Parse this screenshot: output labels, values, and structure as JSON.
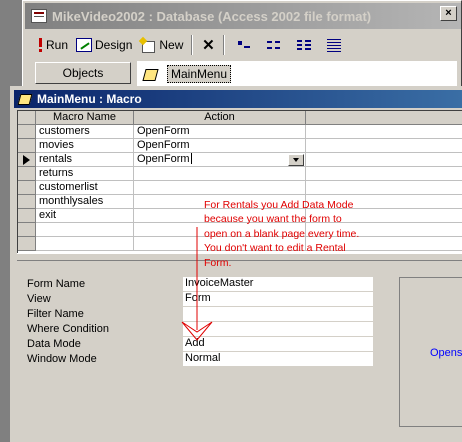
{
  "db_window": {
    "title": "MikeVideo2002 : Database (Access 2002 file format)",
    "close_glyph": "×",
    "toolbar": {
      "run_label": "Run",
      "design_label": "Design",
      "new_label": "New"
    },
    "objects_label": "Objects",
    "selected_object": "MainMenu"
  },
  "macro_window": {
    "title": "MainMenu : Macro",
    "columns": [
      "Macro Name",
      "Action"
    ],
    "rows": [
      {
        "macro_name": "customers",
        "action": "OpenForm"
      },
      {
        "macro_name": "movies",
        "action": "OpenForm"
      },
      {
        "macro_name": "rentals",
        "action": "OpenForm"
      },
      {
        "macro_name": "returns",
        "action": ""
      },
      {
        "macro_name": "customerlist",
        "action": ""
      },
      {
        "macro_name": "monthlysales",
        "action": ""
      },
      {
        "macro_name": "exit",
        "action": ""
      }
    ],
    "current_row": 2
  },
  "action_arguments": {
    "form_name": {
      "label": "Form Name",
      "value": "InvoiceMaster"
    },
    "view": {
      "label": "View",
      "value": "Form"
    },
    "filter_name": {
      "label": "Filter Name",
      "value": ""
    },
    "where_condition": {
      "label": "Where Condition",
      "value": ""
    },
    "data_mode": {
      "label": "Data Mode",
      "value": "Add"
    },
    "window_mode": {
      "label": "Window Mode",
      "value": "Normal"
    }
  },
  "help_text": "Opens",
  "annotation": {
    "text": "For Rentals you Add Data Mode because you want the form to open on a blank page every time. You don't want to edit a Rental Form.",
    "color": "#e00000"
  },
  "colors": {
    "active_title": "#0a246a",
    "inactive_title": "#808080",
    "face": "#d4d0c8",
    "help_link": "#0000ff"
  }
}
